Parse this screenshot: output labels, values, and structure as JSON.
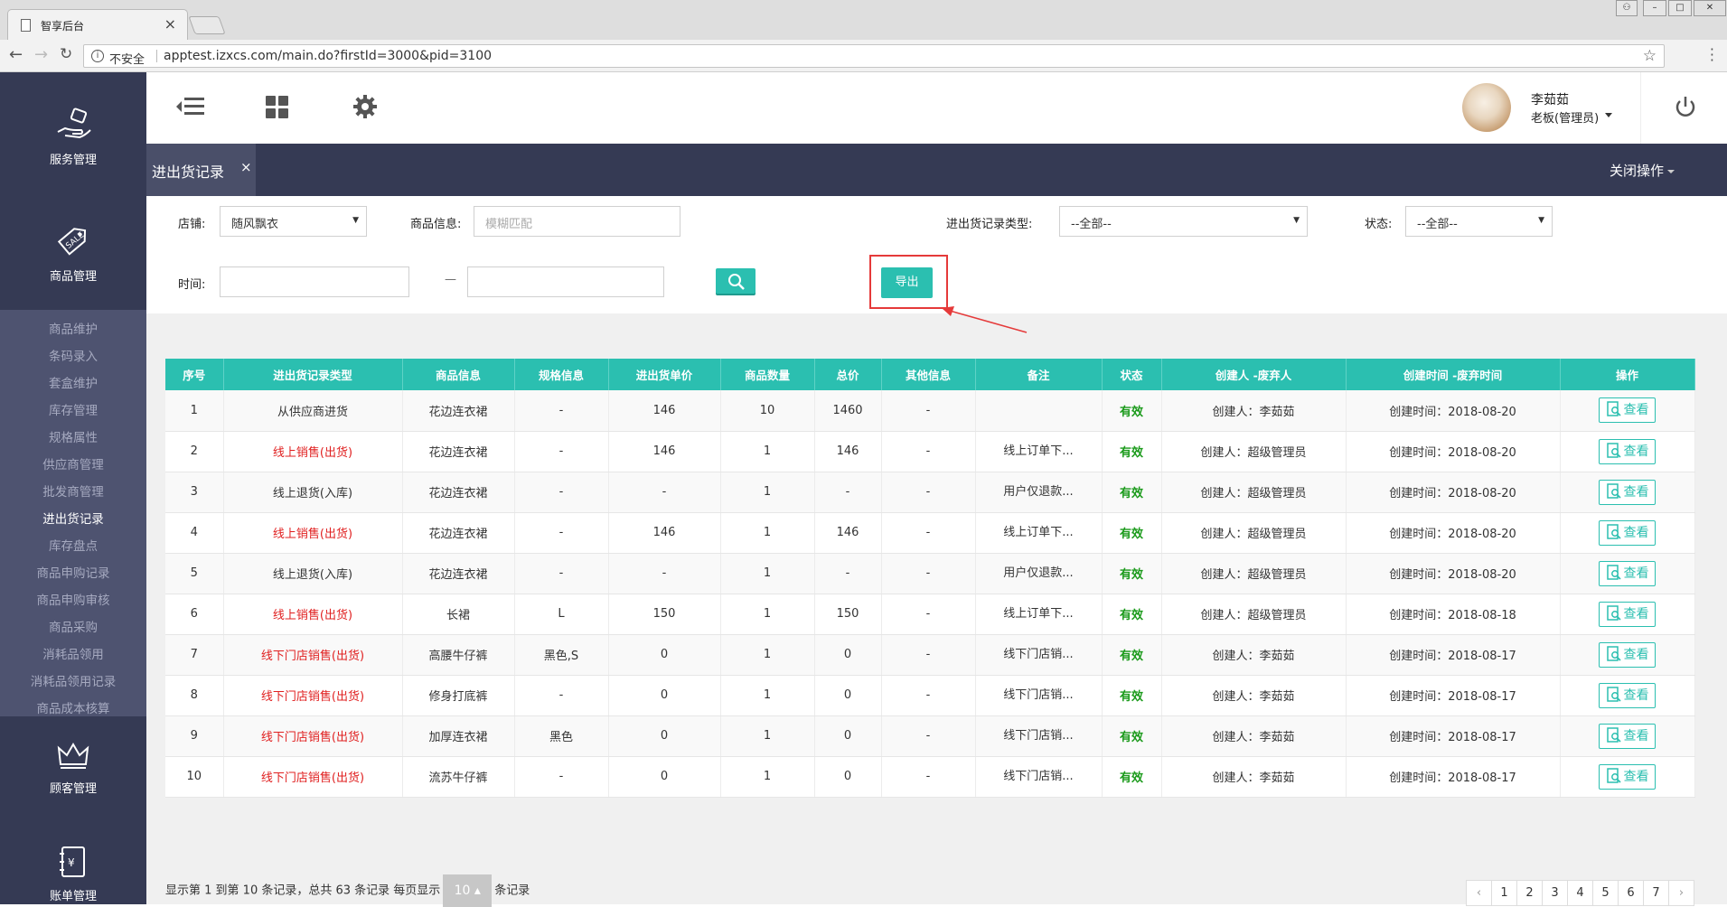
{
  "browser": {
    "tab_title": "智享后台",
    "tab_close": "×",
    "insecure_label": "不安全",
    "url": "apptest.izxcs.com/main.do?firstId=3000&pid=3100"
  },
  "sidebar": {
    "majors": [
      {
        "label": "服务管理",
        "icon": "hand-sale-icon"
      },
      {
        "label": "商品管理",
        "icon": "sale-tag-icon"
      },
      {
        "label": "顾客管理",
        "icon": "crown-icon"
      },
      {
        "label": "账单管理",
        "icon": "ledger-icon"
      }
    ],
    "sub_items": [
      "商品维护",
      "条码录入",
      "套盒维护",
      "库存管理",
      "规格属性",
      "供应商管理",
      "批发商管理",
      "进出货记录",
      "库存盘点",
      "商品申购记录",
      "商品申购审核",
      "商品采购",
      "消耗品领用",
      "消耗品领用记录",
      "商品成本核算"
    ],
    "active_sub": "进出货记录"
  },
  "topbar": {
    "user_name": "李茹茹",
    "user_role": "老板(管理员)"
  },
  "tabbar": {
    "page_tab": "进出货记录",
    "page_tab_close": "×",
    "close_ops": "关闭操作"
  },
  "filter": {
    "store_label": "店铺:",
    "store_value": "随风飘衣",
    "goods_label": "商品信息:",
    "goods_placeholder": "模糊匹配",
    "type_label": "进出货记录类型:",
    "type_value": "--全部--",
    "status_label": "状态:",
    "status_value": "--全部--",
    "time_label": "时间:",
    "time_sep": "—",
    "export_label": "导出"
  },
  "table": {
    "headers": [
      "序号",
      "进出货记录类型",
      "商品信息",
      "规格信息",
      "进出货单价",
      "商品数量",
      "总价",
      "其他信息",
      "备注",
      "状态",
      "创建人 -废弃人",
      "创建时间 -废弃时间",
      "操作"
    ],
    "view_label": "查看",
    "rows": [
      {
        "no": "1",
        "type": "从供应商进货",
        "type_red": false,
        "goods": "花边连衣裙",
        "spec": "-",
        "price": "146",
        "qty": "10",
        "total": "1460",
        "other": "-",
        "note": "",
        "status": "有效",
        "creator": "创建人：李茹茹",
        "time": "创建时间：2018-08-20"
      },
      {
        "no": "2",
        "type": "线上销售(出货)",
        "type_red": true,
        "goods": "花边连衣裙",
        "spec": "-",
        "price": "146",
        "qty": "1",
        "total": "146",
        "other": "-",
        "note": "线上订单下...",
        "status": "有效",
        "creator": "创建人：超级管理员",
        "time": "创建时间：2018-08-20"
      },
      {
        "no": "3",
        "type": "线上退货(入库)",
        "type_red": false,
        "goods": "花边连衣裙",
        "spec": "-",
        "price": "-",
        "qty": "1",
        "total": "-",
        "other": "-",
        "note": "用户仅退款...",
        "status": "有效",
        "creator": "创建人：超级管理员",
        "time": "创建时间：2018-08-20"
      },
      {
        "no": "4",
        "type": "线上销售(出货)",
        "type_red": true,
        "goods": "花边连衣裙",
        "spec": "-",
        "price": "146",
        "qty": "1",
        "total": "146",
        "other": "-",
        "note": "线上订单下...",
        "status": "有效",
        "creator": "创建人：超级管理员",
        "time": "创建时间：2018-08-20"
      },
      {
        "no": "5",
        "type": "线上退货(入库)",
        "type_red": false,
        "goods": "花边连衣裙",
        "spec": "-",
        "price": "-",
        "qty": "1",
        "total": "-",
        "other": "-",
        "note": "用户仅退款...",
        "status": "有效",
        "creator": "创建人：超级管理员",
        "time": "创建时间：2018-08-20"
      },
      {
        "no": "6",
        "type": "线上销售(出货)",
        "type_red": true,
        "goods": "长裙",
        "spec": "L",
        "price": "150",
        "qty": "1",
        "total": "150",
        "other": "-",
        "note": "线上订单下...",
        "status": "有效",
        "creator": "创建人：超级管理员",
        "time": "创建时间：2018-08-18"
      },
      {
        "no": "7",
        "type": "线下门店销售(出货)",
        "type_red": true,
        "goods": "高腰牛仔裤",
        "spec": "黑色,S",
        "price": "0",
        "qty": "1",
        "total": "0",
        "other": "-",
        "note": "线下门店销...",
        "status": "有效",
        "creator": "创建人：李茹茹",
        "time": "创建时间：2018-08-17"
      },
      {
        "no": "8",
        "type": "线下门店销售(出货)",
        "type_red": true,
        "goods": "修身打底裤",
        "spec": "-",
        "price": "0",
        "qty": "1",
        "total": "0",
        "other": "-",
        "note": "线下门店销...",
        "status": "有效",
        "creator": "创建人：李茹茹",
        "time": "创建时间：2018-08-17"
      },
      {
        "no": "9",
        "type": "线下门店销售(出货)",
        "type_red": true,
        "goods": "加厚连衣裙",
        "spec": "黑色",
        "price": "0",
        "qty": "1",
        "total": "0",
        "other": "-",
        "note": "线下门店销...",
        "status": "有效",
        "creator": "创建人：李茹茹",
        "time": "创建时间：2018-08-17"
      },
      {
        "no": "10",
        "type": "线下门店销售(出货)",
        "type_red": true,
        "goods": "流苏牛仔裤",
        "spec": "-",
        "price": "0",
        "qty": "1",
        "total": "0",
        "other": "-",
        "note": "线下门店销...",
        "status": "有效",
        "creator": "创建人：李茹茹",
        "time": "创建时间：2018-08-17"
      }
    ]
  },
  "footer": {
    "info_prefix": "显示第 1 到第 10 条记录，总共 63 条记录 每页显示",
    "page_size": "10",
    "info_suffix": "条记录",
    "pages": [
      "1",
      "2",
      "3",
      "4",
      "5",
      "6",
      "7"
    ],
    "prev": "‹",
    "next": "›"
  },
  "colors": {
    "accent": "#2bbfb0",
    "sidebar": "#353a54",
    "danger": "#e02020",
    "valid": "#1a9a1a"
  }
}
